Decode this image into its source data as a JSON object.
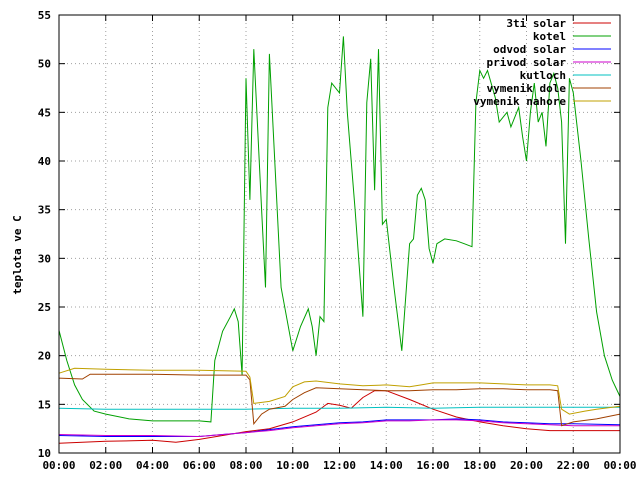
{
  "chart_data": {
    "type": "line",
    "title": "",
    "xlabel": "",
    "ylabel": "teplota ve C",
    "ylim": [
      10,
      55
    ],
    "xlim": [
      "00:00",
      "24:00"
    ],
    "x_ticks": [
      "00:00",
      "02:00",
      "04:00",
      "06:00",
      "08:00",
      "10:00",
      "12:00",
      "14:00",
      "16:00",
      "18:00",
      "20:00",
      "22:00",
      "00:00"
    ],
    "y_ticks": [
      10,
      15,
      20,
      25,
      30,
      35,
      40,
      45,
      50,
      55
    ],
    "grid": true,
    "legend_position": "top-right",
    "series": [
      {
        "name": "3ti solar",
        "color": "#cc0000",
        "points": [
          [
            "00:00",
            11.0
          ],
          [
            "02:00",
            11.2
          ],
          [
            "04:00",
            11.3
          ],
          [
            "05:00",
            11.1
          ],
          [
            "06:00",
            11.4
          ],
          [
            "07:00",
            11.8
          ],
          [
            "08:00",
            12.2
          ],
          [
            "09:00",
            12.5
          ],
          [
            "10:00",
            13.2
          ],
          [
            "11:00",
            14.2
          ],
          [
            "11:30",
            15.1
          ],
          [
            "12:00",
            14.9
          ],
          [
            "12:30",
            14.6
          ],
          [
            "13:00",
            15.7
          ],
          [
            "13:30",
            16.4
          ],
          [
            "14:00",
            16.4
          ],
          [
            "15:00",
            15.5
          ],
          [
            "16:00",
            14.5
          ],
          [
            "17:00",
            13.7
          ],
          [
            "18:00",
            13.2
          ],
          [
            "19:00",
            12.8
          ],
          [
            "20:00",
            12.5
          ],
          [
            "21:00",
            12.3
          ],
          [
            "22:00",
            12.3
          ],
          [
            "24:00",
            12.3
          ]
        ]
      },
      {
        "name": "kotel",
        "color": "#00a000",
        "points": [
          [
            "00:00",
            22.6
          ],
          [
            "00:20",
            19.5
          ],
          [
            "00:40",
            17.0
          ],
          [
            "01:00",
            15.5
          ],
          [
            "01:30",
            14.3
          ],
          [
            "02:00",
            14.0
          ],
          [
            "03:00",
            13.5
          ],
          [
            "04:00",
            13.3
          ],
          [
            "05:00",
            13.3
          ],
          [
            "06:00",
            13.3
          ],
          [
            "06:30",
            13.2
          ],
          [
            "06:40",
            19.5
          ],
          [
            "07:00",
            22.5
          ],
          [
            "07:20",
            24.0
          ],
          [
            "07:30",
            24.8
          ],
          [
            "07:40",
            23.5
          ],
          [
            "07:50",
            18.0
          ],
          [
            "08:00",
            48.5
          ],
          [
            "08:10",
            36.0
          ],
          [
            "08:20",
            51.5
          ],
          [
            "08:40",
            35.0
          ],
          [
            "08:50",
            27.0
          ],
          [
            "09:00",
            51.0
          ],
          [
            "09:10",
            43.0
          ],
          [
            "09:30",
            27.0
          ],
          [
            "10:00",
            20.5
          ],
          [
            "10:20",
            23.0
          ],
          [
            "10:40",
            24.8
          ],
          [
            "10:50",
            23.0
          ],
          [
            "11:00",
            20.0
          ],
          [
            "11:10",
            24.0
          ],
          [
            "11:20",
            23.5
          ],
          [
            "11:30",
            45.5
          ],
          [
            "11:40",
            48.0
          ],
          [
            "12:00",
            47.0
          ],
          [
            "12:10",
            52.8
          ],
          [
            "12:20",
            45.0
          ],
          [
            "12:40",
            35.0
          ],
          [
            "13:00",
            24.0
          ],
          [
            "13:10",
            46.0
          ],
          [
            "13:20",
            50.5
          ],
          [
            "13:30",
            37.0
          ],
          [
            "13:40",
            51.5
          ],
          [
            "13:50",
            33.5
          ],
          [
            "14:00",
            34.0
          ],
          [
            "14:20",
            27.0
          ],
          [
            "14:40",
            20.5
          ],
          [
            "15:00",
            31.5
          ],
          [
            "15:10",
            32.0
          ],
          [
            "15:20",
            36.5
          ],
          [
            "15:30",
            37.2
          ],
          [
            "15:40",
            36.0
          ],
          [
            "15:50",
            31.0
          ],
          [
            "16:00",
            29.5
          ],
          [
            "16:10",
            31.5
          ],
          [
            "16:30",
            32.0
          ],
          [
            "17:00",
            31.8
          ],
          [
            "17:20",
            31.5
          ],
          [
            "17:40",
            31.2
          ],
          [
            "17:50",
            46.0
          ],
          [
            "18:00",
            49.3
          ],
          [
            "18:10",
            48.5
          ],
          [
            "18:20",
            49.3
          ],
          [
            "18:40",
            46.5
          ],
          [
            "18:50",
            44.0
          ],
          [
            "19:00",
            44.5
          ],
          [
            "19:10",
            45.0
          ],
          [
            "19:20",
            43.5
          ],
          [
            "19:40",
            45.5
          ],
          [
            "19:50",
            42.5
          ],
          [
            "20:00",
            40.0
          ],
          [
            "20:10",
            45.0
          ],
          [
            "20:20",
            48.0
          ],
          [
            "20:30",
            44.0
          ],
          [
            "20:40",
            45.0
          ],
          [
            "20:50",
            41.5
          ],
          [
            "21:00",
            48.0
          ],
          [
            "21:10",
            49.0
          ],
          [
            "21:20",
            47.5
          ],
          [
            "21:30",
            44.0
          ],
          [
            "21:40",
            31.5
          ],
          [
            "21:50",
            48.5
          ],
          [
            "22:00",
            47.0
          ],
          [
            "22:20",
            40.0
          ],
          [
            "22:40",
            32.0
          ],
          [
            "23:00",
            24.5
          ],
          [
            "23:20",
            20.0
          ],
          [
            "23:40",
            17.5
          ],
          [
            "24:00",
            15.8
          ]
        ]
      },
      {
        "name": "odvod solar",
        "color": "#0000ff",
        "points": [
          [
            "00:00",
            11.8
          ],
          [
            "02:00",
            11.7
          ],
          [
            "04:00",
            11.7
          ],
          [
            "06:00",
            11.7
          ],
          [
            "07:00",
            11.9
          ],
          [
            "08:00",
            12.1
          ],
          [
            "09:00",
            12.4
          ],
          [
            "10:00",
            12.7
          ],
          [
            "11:00",
            12.9
          ],
          [
            "12:00",
            13.1
          ],
          [
            "13:00",
            13.2
          ],
          [
            "14:00",
            13.4
          ],
          [
            "15:00",
            13.4
          ],
          [
            "16:00",
            13.4
          ],
          [
            "17:00",
            13.5
          ],
          [
            "18:00",
            13.4
          ],
          [
            "19:00",
            13.2
          ],
          [
            "20:00",
            13.1
          ],
          [
            "21:00",
            13.0
          ],
          [
            "22:00",
            13.0
          ],
          [
            "24:00",
            12.9
          ]
        ]
      },
      {
        "name": "privod solar",
        "color": "#cc00cc",
        "points": [
          [
            "00:00",
            11.9
          ],
          [
            "02:00",
            11.8
          ],
          [
            "04:00",
            11.8
          ],
          [
            "06:00",
            11.7
          ],
          [
            "07:00",
            11.9
          ],
          [
            "08:00",
            12.1
          ],
          [
            "09:00",
            12.3
          ],
          [
            "10:00",
            12.6
          ],
          [
            "11:00",
            12.8
          ],
          [
            "12:00",
            13.0
          ],
          [
            "13:00",
            13.1
          ],
          [
            "14:00",
            13.3
          ],
          [
            "15:00",
            13.3
          ],
          [
            "16:00",
            13.4
          ],
          [
            "17:00",
            13.4
          ],
          [
            "18:00",
            13.3
          ],
          [
            "19:00",
            13.1
          ],
          [
            "20:00",
            13.0
          ],
          [
            "21:00",
            12.9
          ],
          [
            "22:00",
            12.8
          ],
          [
            "24:00",
            12.8
          ]
        ]
      },
      {
        "name": "kutloch",
        "color": "#00c0c0",
        "points": [
          [
            "00:00",
            14.6
          ],
          [
            "02:00",
            14.5
          ],
          [
            "04:00",
            14.5
          ],
          [
            "06:00",
            14.5
          ],
          [
            "08:00",
            14.5
          ],
          [
            "10:00",
            14.6
          ],
          [
            "12:00",
            14.6
          ],
          [
            "14:00",
            14.7
          ],
          [
            "16:00",
            14.6
          ],
          [
            "18:00",
            14.7
          ],
          [
            "20:00",
            14.7
          ],
          [
            "22:00",
            14.7
          ],
          [
            "24:00",
            14.7
          ]
        ]
      },
      {
        "name": "vymenik dole",
        "color": "#a04000",
        "points": [
          [
            "00:00",
            17.7
          ],
          [
            "01:00",
            17.6
          ],
          [
            "01:20",
            18.1
          ],
          [
            "02:00",
            18.1
          ],
          [
            "04:00",
            18.1
          ],
          [
            "06:00",
            18.0
          ],
          [
            "07:00",
            18.0
          ],
          [
            "08:00",
            18.0
          ],
          [
            "08:10",
            17.5
          ],
          [
            "08:20",
            13.0
          ],
          [
            "08:40",
            14.0
          ],
          [
            "09:00",
            14.5
          ],
          [
            "09:40",
            14.8
          ],
          [
            "10:00",
            15.5
          ],
          [
            "10:30",
            16.2
          ],
          [
            "11:00",
            16.7
          ],
          [
            "12:00",
            16.6
          ],
          [
            "13:00",
            16.5
          ],
          [
            "14:00",
            16.4
          ],
          [
            "15:00",
            16.4
          ],
          [
            "16:00",
            16.5
          ],
          [
            "17:00",
            16.5
          ],
          [
            "18:00",
            16.6
          ],
          [
            "19:00",
            16.6
          ],
          [
            "20:00",
            16.5
          ],
          [
            "21:00",
            16.5
          ],
          [
            "21:20",
            16.4
          ],
          [
            "21:30",
            12.8
          ],
          [
            "22:00",
            13.2
          ],
          [
            "23:00",
            13.5
          ],
          [
            "24:00",
            14.0
          ]
        ]
      },
      {
        "name": "vymenik nahore",
        "color": "#c0a000",
        "points": [
          [
            "00:00",
            18.2
          ],
          [
            "00:40",
            18.7
          ],
          [
            "02:00",
            18.6
          ],
          [
            "04:00",
            18.5
          ],
          [
            "06:00",
            18.5
          ],
          [
            "08:00",
            18.4
          ],
          [
            "08:10",
            17.8
          ],
          [
            "08:20",
            15.1
          ],
          [
            "09:00",
            15.3
          ],
          [
            "09:40",
            15.8
          ],
          [
            "10:00",
            16.8
          ],
          [
            "10:30",
            17.3
          ],
          [
            "11:00",
            17.4
          ],
          [
            "12:00",
            17.1
          ],
          [
            "13:00",
            16.9
          ],
          [
            "14:00",
            17.0
          ],
          [
            "15:00",
            16.8
          ],
          [
            "15:30",
            17.0
          ],
          [
            "16:00",
            17.2
          ],
          [
            "17:00",
            17.2
          ],
          [
            "18:00",
            17.2
          ],
          [
            "19:00",
            17.1
          ],
          [
            "20:00",
            17.0
          ],
          [
            "21:00",
            17.0
          ],
          [
            "21:20",
            16.9
          ],
          [
            "21:30",
            14.5
          ],
          [
            "21:50",
            14.0
          ],
          [
            "22:30",
            14.3
          ],
          [
            "23:00",
            14.5
          ],
          [
            "24:00",
            14.8
          ]
        ]
      }
    ]
  }
}
